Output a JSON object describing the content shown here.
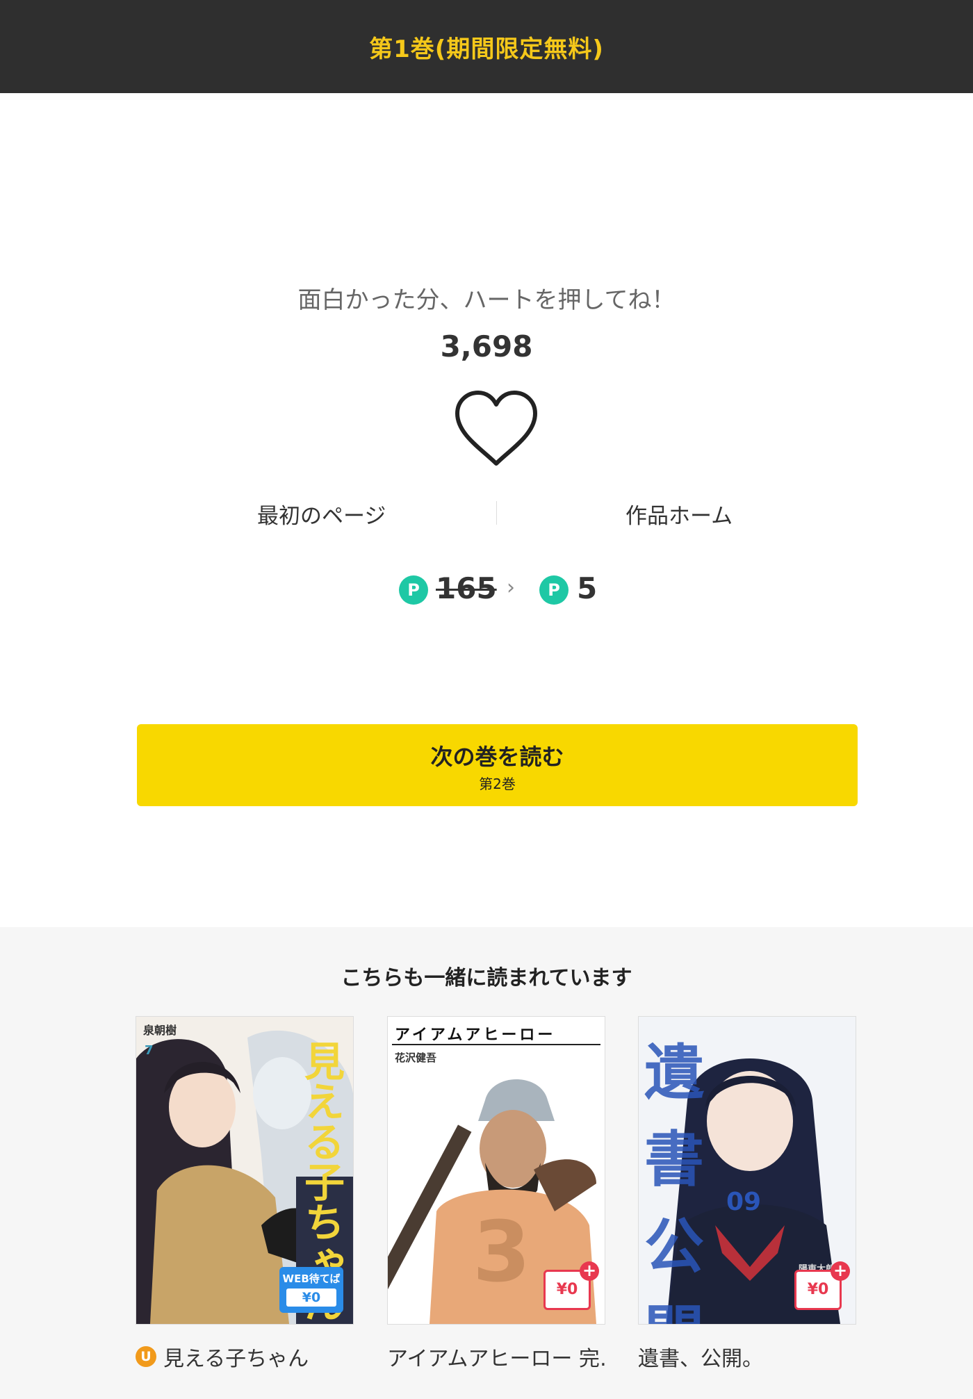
{
  "header": {
    "title": "第1巻(期間限定無料)"
  },
  "like": {
    "prompt": "面白かった分、ハートを押してね！",
    "count": "3,698",
    "icon": "heart-outline-icon"
  },
  "links": {
    "first_page": "最初のページ",
    "work_home": "作品ホーム"
  },
  "price": {
    "point_symbol": "P",
    "original": "165",
    "arrow": "›",
    "discounted": "5"
  },
  "next_button": {
    "label": "次の巻を読む",
    "sub": "第2巻"
  },
  "recommendations": {
    "title": "こちらも一緒に読まれています",
    "items": [
      {
        "cover_title": "見える子ちゃん",
        "cover_author": "泉朝樹",
        "volume": "7",
        "badge_top": "WEB待てば",
        "badge_price": "¥0",
        "caption_badge": "U",
        "caption": "見える子ちゃん"
      },
      {
        "cover_title": "アイアムアヒーロー",
        "cover_author": "花沢健吾",
        "volume": "3",
        "badge_price": "¥0",
        "badge_plus": "+",
        "caption": "アイアムアヒーロー 完…"
      },
      {
        "cover_title": "遺書公開",
        "cover_author": "陽東太郎",
        "volume": "09",
        "badge_price": "¥0",
        "badge_plus": "+",
        "caption": "遺書、公開。"
      }
    ]
  },
  "colors": {
    "header_bg": "#2f2f2f",
    "header_text": "#f5c81a",
    "button_yellow": "#f8d800",
    "point_green": "#1ec8a5",
    "free_red": "#e8384f",
    "web_blue": "#2a8ce8",
    "u_orange": "#f19a1b"
  }
}
